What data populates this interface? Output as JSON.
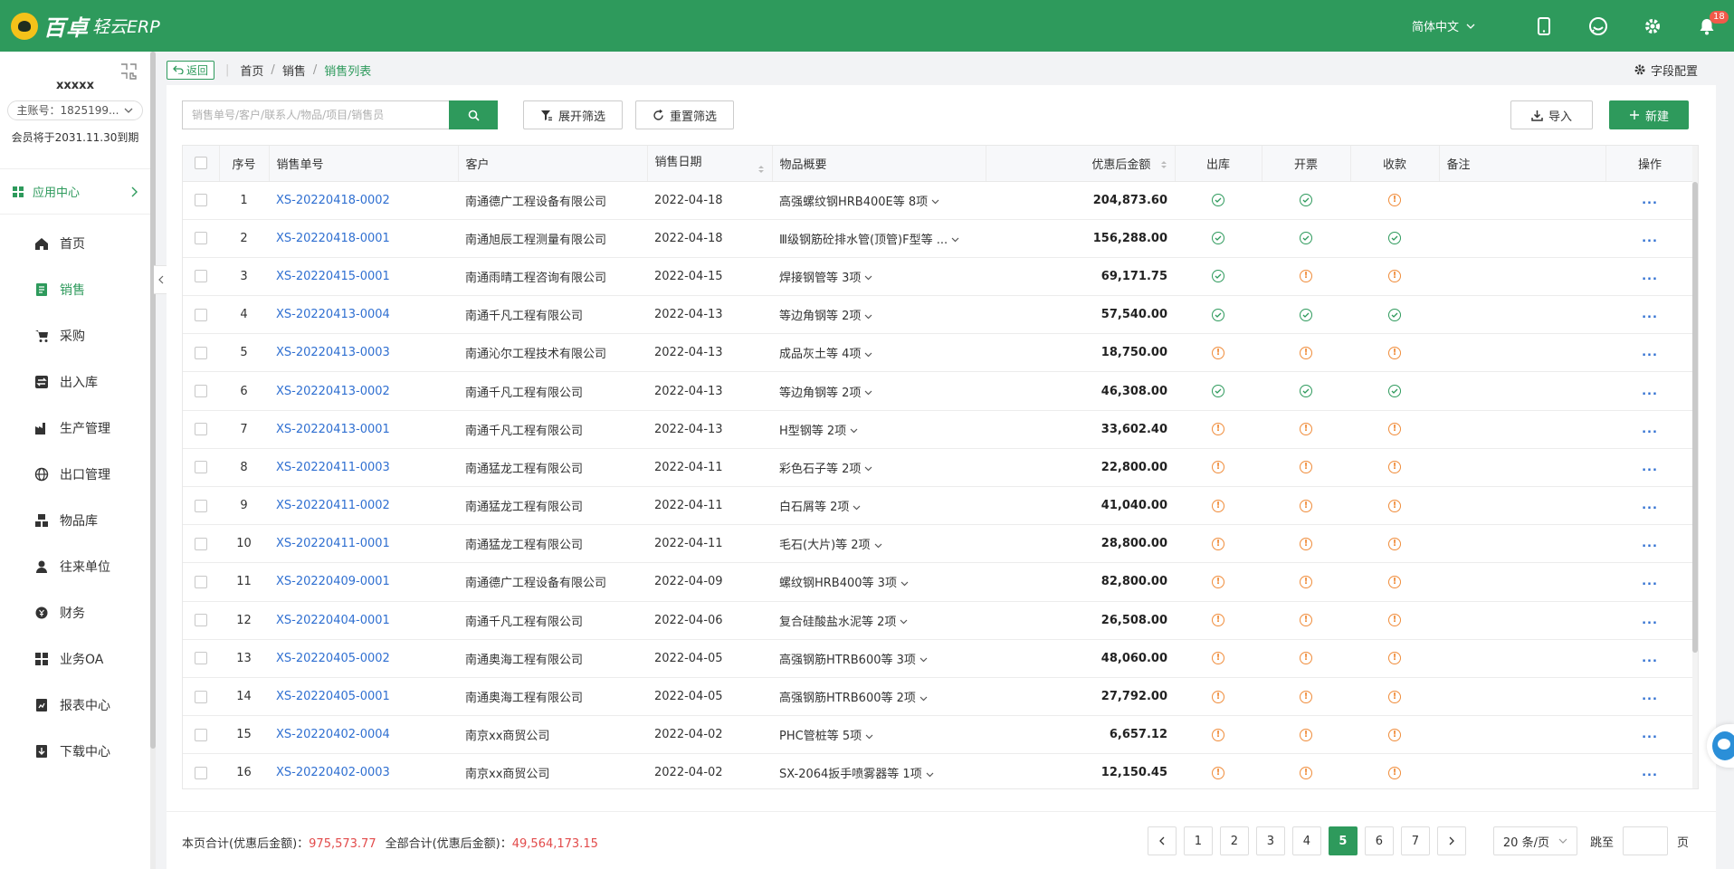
{
  "app": {
    "brand": "百卓",
    "brand_sub": "轻云ERP",
    "language": "简体中文",
    "notification_count": "18",
    "brand_color": "#2e9a5c"
  },
  "sidebar": {
    "username": "xxxxx",
    "account": "主账号：1825199...",
    "expire": "会员将于2031.11.30到期",
    "app_center": "应用中心",
    "items": [
      {
        "label": "首页",
        "icon": "home-icon"
      },
      {
        "label": "销售",
        "icon": "sales-doc-icon",
        "active": true
      },
      {
        "label": "采购",
        "icon": "cart-icon"
      },
      {
        "label": "出入库",
        "icon": "swap-icon"
      },
      {
        "label": "生产管理",
        "icon": "factory-icon"
      },
      {
        "label": "出口管理",
        "icon": "globe-icon"
      },
      {
        "label": "物品库",
        "icon": "boxes-icon"
      },
      {
        "label": "往来单位",
        "icon": "person-icon"
      },
      {
        "label": "财务",
        "icon": "coin-icon"
      },
      {
        "label": "业务OA",
        "icon": "grid-icon"
      },
      {
        "label": "报表中心",
        "icon": "report-icon"
      },
      {
        "label": "下载中心",
        "icon": "download-icon"
      }
    ]
  },
  "breadcrumb": {
    "back": "返回",
    "items": [
      "首页",
      "销售",
      "销售列表"
    ],
    "field_config": "字段配置"
  },
  "toolbar": {
    "search_placeholder": "销售单号/客户/联系人/物品/项目/销售员",
    "expand_filter": "展开筛选",
    "reset_filter": "重置筛选",
    "import": "导入",
    "new": "新建"
  },
  "table": {
    "columns": {
      "index": "序号",
      "order_no": "销售单号",
      "customer": "客户",
      "date": "销售日期",
      "items": "物品概要",
      "amount": "优惠后金额",
      "outbound": "出库",
      "invoice": "开票",
      "payment": "收款",
      "remark": "备注",
      "actions": "操作"
    },
    "rows": [
      {
        "index": "1",
        "order_no": "XS-20220418-0002",
        "customer": "南通德广工程设备有限公司",
        "date": "2022-04-18",
        "items": "高强螺纹钢HRB400E等 8项",
        "amount": "204,873.60",
        "outbound": "ok",
        "invoice": "ok",
        "payment": "warn",
        "remark": "",
        "actions": "..."
      },
      {
        "index": "2",
        "order_no": "XS-20220418-0001",
        "customer": "南通旭辰工程测量有限公司",
        "date": "2022-04-18",
        "items": "Ⅲ级钢筋砼排水管(顶管)F型等 ...",
        "amount": "156,288.00",
        "outbound": "ok",
        "invoice": "ok",
        "payment": "ok",
        "remark": "",
        "actions": "..."
      },
      {
        "index": "3",
        "order_no": "XS-20220415-0001",
        "customer": "南通雨晴工程咨询有限公司",
        "date": "2022-04-15",
        "items": "焊接钢管等 3项",
        "amount": "69,171.75",
        "outbound": "ok",
        "invoice": "warn",
        "payment": "warn",
        "remark": "",
        "actions": "..."
      },
      {
        "index": "4",
        "order_no": "XS-20220413-0004",
        "customer": "南通千凡工程有限公司",
        "date": "2022-04-13",
        "items": "等边角钢等 2项",
        "amount": "57,540.00",
        "outbound": "ok",
        "invoice": "ok",
        "payment": "ok",
        "remark": "",
        "actions": "..."
      },
      {
        "index": "5",
        "order_no": "XS-20220413-0003",
        "customer": "南通沁尔工程技术有限公司",
        "date": "2022-04-13",
        "items": "成品灰土等 4项",
        "amount": "18,750.00",
        "outbound": "warn",
        "invoice": "warn",
        "payment": "warn",
        "remark": "",
        "actions": "..."
      },
      {
        "index": "6",
        "order_no": "XS-20220413-0002",
        "customer": "南通千凡工程有限公司",
        "date": "2022-04-13",
        "items": "等边角钢等 2项",
        "amount": "46,308.00",
        "outbound": "ok",
        "invoice": "ok",
        "payment": "ok",
        "remark": "",
        "actions": "..."
      },
      {
        "index": "7",
        "order_no": "XS-20220413-0001",
        "customer": "南通千凡工程有限公司",
        "date": "2022-04-13",
        "items": "H型钢等 2项",
        "amount": "33,602.40",
        "outbound": "warn",
        "invoice": "warn",
        "payment": "warn",
        "remark": "",
        "actions": "..."
      },
      {
        "index": "8",
        "order_no": "XS-20220411-0003",
        "customer": "南通猛龙工程有限公司",
        "date": "2022-04-11",
        "items": "彩色石子等 2项",
        "amount": "22,800.00",
        "outbound": "warn",
        "invoice": "warn",
        "payment": "warn",
        "remark": "",
        "actions": "..."
      },
      {
        "index": "9",
        "order_no": "XS-20220411-0002",
        "customer": "南通猛龙工程有限公司",
        "date": "2022-04-11",
        "items": "白石屑等 2项",
        "amount": "41,040.00",
        "outbound": "warn",
        "invoice": "warn",
        "payment": "warn",
        "remark": "",
        "actions": "..."
      },
      {
        "index": "10",
        "order_no": "XS-20220411-0001",
        "customer": "南通猛龙工程有限公司",
        "date": "2022-04-11",
        "items": "毛石(大片)等 2项",
        "amount": "28,800.00",
        "outbound": "warn",
        "invoice": "warn",
        "payment": "warn",
        "remark": "",
        "actions": "..."
      },
      {
        "index": "11",
        "order_no": "XS-20220409-0001",
        "customer": "南通德广工程设备有限公司",
        "date": "2022-04-09",
        "items": "螺纹钢HRB400等 3项",
        "amount": "82,800.00",
        "outbound": "warn",
        "invoice": "warn",
        "payment": "warn",
        "remark": "",
        "actions": "..."
      },
      {
        "index": "12",
        "order_no": "XS-20220404-0001",
        "customer": "南通千凡工程有限公司",
        "date": "2022-04-06",
        "items": "复合硅酸盐水泥等 2项",
        "amount": "26,508.00",
        "outbound": "warn",
        "invoice": "warn",
        "payment": "warn",
        "remark": "",
        "actions": "..."
      },
      {
        "index": "13",
        "order_no": "XS-20220405-0002",
        "customer": "南通奥海工程有限公司",
        "date": "2022-04-05",
        "items": "高强钢筋HTRB600等 3项",
        "amount": "48,060.00",
        "outbound": "warn",
        "invoice": "warn",
        "payment": "warn",
        "remark": "",
        "actions": "..."
      },
      {
        "index": "14",
        "order_no": "XS-20220405-0001",
        "customer": "南通奥海工程有限公司",
        "date": "2022-04-05",
        "items": "高强钢筋HTRB600等 2项",
        "amount": "27,792.00",
        "outbound": "warn",
        "invoice": "warn",
        "payment": "warn",
        "remark": "",
        "actions": "..."
      },
      {
        "index": "15",
        "order_no": "XS-20220402-0004",
        "customer": "南京xx商贸公司",
        "date": "2022-04-02",
        "items": "PHC管桩等 5项",
        "amount": "6,657.12",
        "outbound": "warn",
        "invoice": "warn",
        "payment": "warn",
        "remark": "",
        "actions": "..."
      },
      {
        "index": "16",
        "order_no": "XS-20220402-0003",
        "customer": "南京xx商贸公司",
        "date": "2022-04-02",
        "items": "SX-2064扳手喷雾器等 1项",
        "amount": "12,150.45",
        "outbound": "warn",
        "invoice": "warn",
        "payment": "warn",
        "remark": "",
        "actions": "..."
      }
    ]
  },
  "footer": {
    "page_total_label": "本页合计(优惠后金额)：",
    "page_total": "975,573.77",
    "all_total_label": "全部合计(优惠后金额)：",
    "all_total": "49,564,173.15",
    "pages": [
      "1",
      "2",
      "3",
      "4",
      "5",
      "6",
      "7"
    ],
    "current_page": "5",
    "page_size": "20 条/页",
    "goto_label": "跳至",
    "page_unit": "页"
  }
}
